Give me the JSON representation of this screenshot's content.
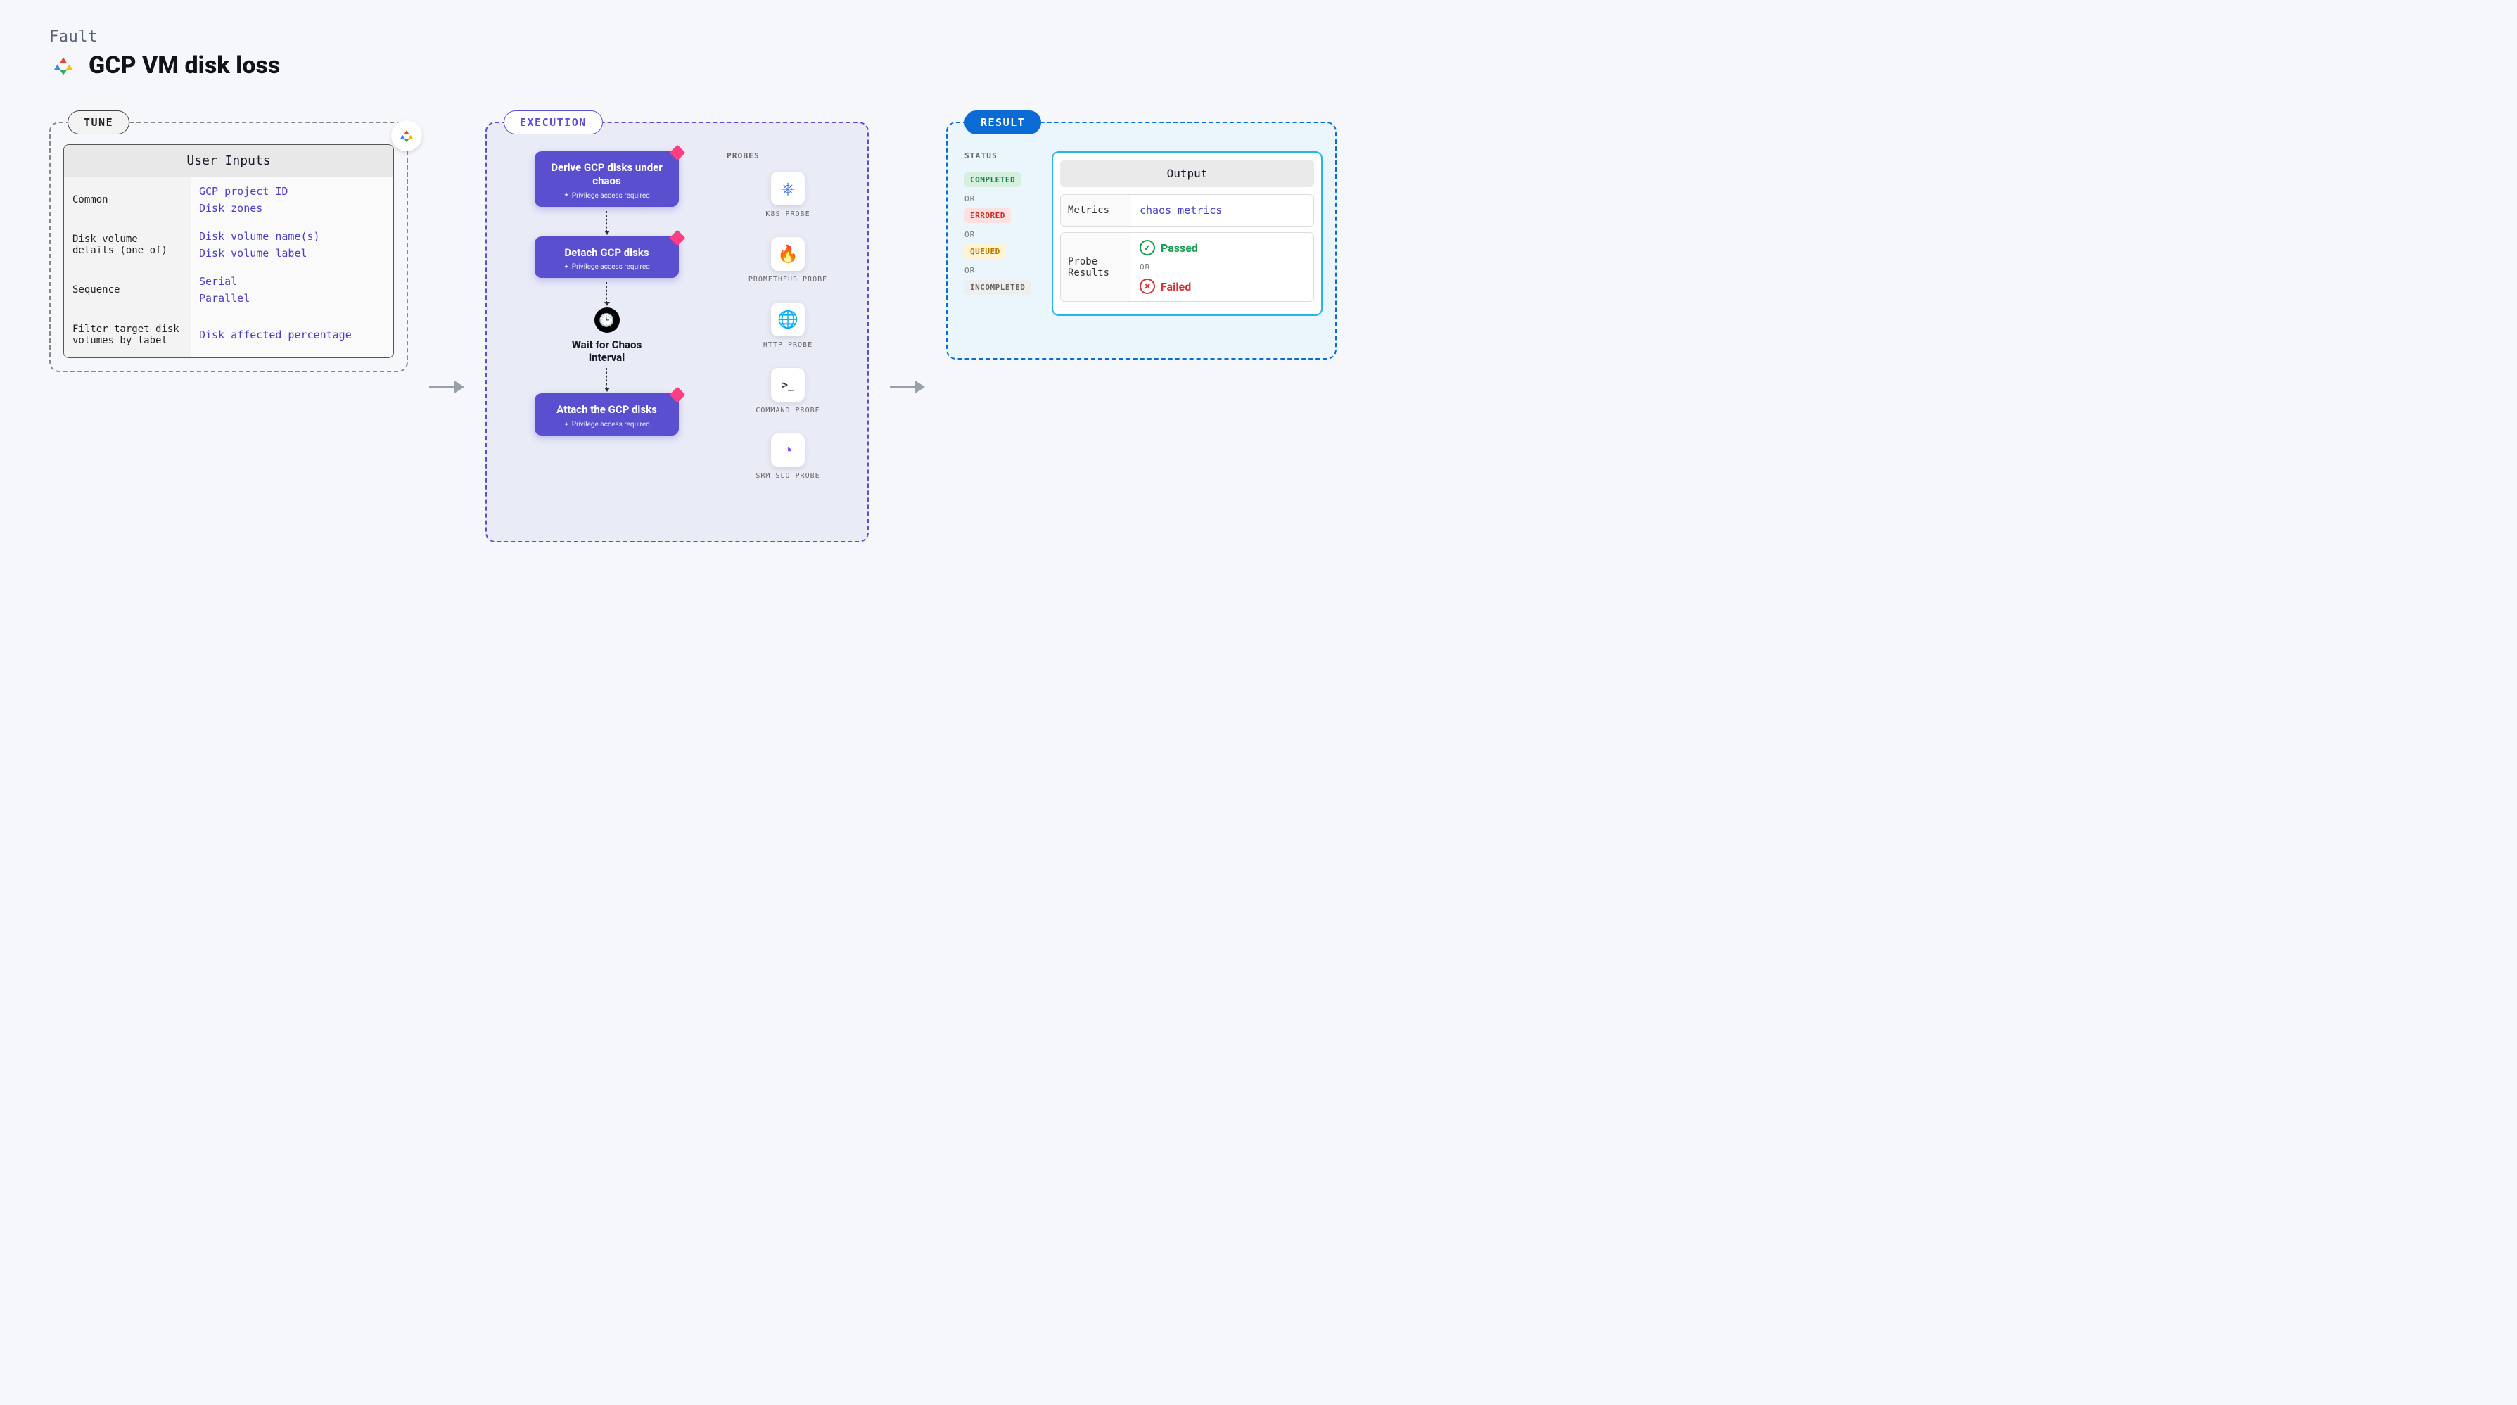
{
  "header": {
    "fault_label": "Fault",
    "title": "GCP VM disk loss"
  },
  "tune": {
    "pill": "TUNE",
    "table_title": "User Inputs",
    "rows": [
      {
        "key": "Common",
        "values": [
          "GCP project ID",
          "Disk zones"
        ]
      },
      {
        "key": "Disk volume details (one of)",
        "values": [
          "Disk volume name(s)",
          "Disk volume label"
        ]
      },
      {
        "key": "Sequence",
        "values": [
          "Serial",
          "Parallel"
        ]
      },
      {
        "key": "Filter target disk volumes by label",
        "values": [
          "Disk affected percentage"
        ]
      }
    ]
  },
  "execution": {
    "pill": "EXECUTION",
    "priv_text": "Privilege access required",
    "steps": [
      {
        "title": "Derive GCP disks under chaos",
        "priv": true
      },
      {
        "title": "Detach GCP disks",
        "priv": true
      }
    ],
    "wait_label": "Wait for Chaos Interval",
    "final_step": {
      "title": "Attach the GCP disks",
      "priv": true
    },
    "probes_label": "PROBES",
    "probes": [
      {
        "name": "K8S PROBE",
        "glyph": "⎈",
        "color": "#326ce5"
      },
      {
        "name": "PROMETHEUS PROBE",
        "glyph": "🔥",
        "color": "#e6522c"
      },
      {
        "name": "HTTP PROBE",
        "glyph": "🌐",
        "color": "#2a7de1"
      },
      {
        "name": "COMMAND PROBE",
        "glyph": ">_",
        "color": "#333"
      },
      {
        "name": "SRM SLO PROBE",
        "glyph": "◔",
        "color": "#8a4fff"
      }
    ]
  },
  "result": {
    "pill": "RESULT",
    "status_label": "STATUS",
    "statuses": [
      "COMPLETED",
      "ERRORED",
      "QUEUED",
      "INCOMPLETED"
    ],
    "or": "OR",
    "output_title": "Output",
    "metrics_key": "Metrics",
    "metrics_val": "chaos metrics",
    "probe_results_key": "Probe Results",
    "passed": "Passed",
    "failed": "Failed"
  }
}
